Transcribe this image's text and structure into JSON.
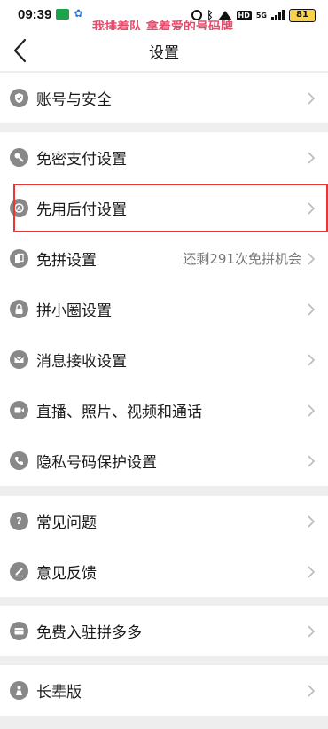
{
  "status_bar": {
    "time": "09:39",
    "overlay_text": "我排着队 拿着爱的号码牌",
    "hd": "HD",
    "network": "5G",
    "battery": "81"
  },
  "header": {
    "title": "设置"
  },
  "sections": [
    {
      "items": [
        {
          "label": "账号与安全",
          "icon": "shield-icon"
        }
      ]
    },
    {
      "items": [
        {
          "label": "免密支付设置",
          "icon": "key-icon"
        },
        {
          "label": "先用后付设置",
          "icon": "badge-icon"
        },
        {
          "label": "免拼设置",
          "icon": "copy-icon",
          "value": "还剩291次免拼机会"
        },
        {
          "label": "拼小圈设置",
          "icon": "lock-icon"
        },
        {
          "label": "消息接收设置",
          "icon": "mail-icon"
        },
        {
          "label": "直播、照片、视频和通话",
          "icon": "video-icon"
        },
        {
          "label": "隐私号码保护设置",
          "icon": "phone-icon"
        }
      ]
    },
    {
      "items": [
        {
          "label": "常见问题",
          "icon": "question-icon"
        },
        {
          "label": "意见反馈",
          "icon": "edit-icon"
        }
      ]
    },
    {
      "items": [
        {
          "label": "免费入驻拼多多",
          "icon": "store-icon"
        }
      ]
    },
    {
      "items": [
        {
          "label": "长辈版",
          "icon": "elder-icon"
        }
      ]
    }
  ],
  "colors": {
    "highlight": "#e83535",
    "overlay_text": "#e84a6a",
    "icon_gray": "#888888"
  }
}
